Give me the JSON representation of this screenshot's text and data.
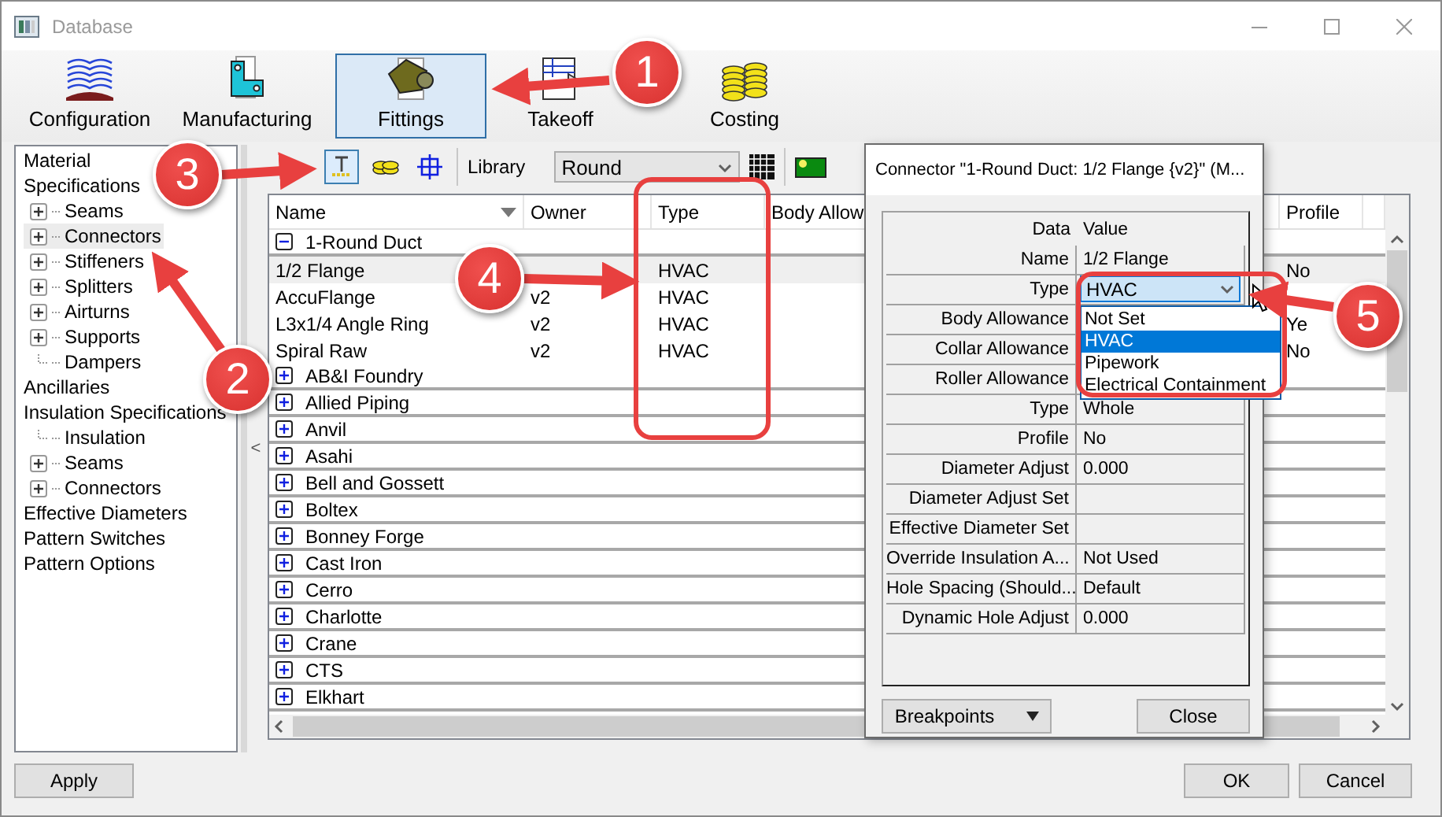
{
  "window": {
    "title": "Database"
  },
  "ribbon": [
    {
      "label": "Configuration",
      "selected": false
    },
    {
      "label": "Manufacturing",
      "selected": false
    },
    {
      "label": "Fittings",
      "selected": true
    },
    {
      "label": "Takeoff",
      "selected": false
    },
    {
      "label": "Costing",
      "selected": false
    }
  ],
  "sidebar": {
    "collapse_button": "<",
    "items": [
      {
        "label": "Material",
        "selected": false
      },
      {
        "label": "Specifications",
        "selected": false,
        "children": [
          {
            "label": "Seams",
            "expandable": true,
            "selected": false
          },
          {
            "label": "Connectors",
            "expandable": true,
            "selected": true
          },
          {
            "label": "Stiffeners",
            "expandable": true,
            "selected": false
          },
          {
            "label": "Splitters",
            "expandable": true,
            "selected": false
          },
          {
            "label": "Airturns",
            "expandable": true,
            "selected": false
          },
          {
            "label": "Supports",
            "expandable": true,
            "selected": false
          },
          {
            "label": "Dampers",
            "expandable": false,
            "selected": false
          }
        ]
      },
      {
        "label": "Ancillaries",
        "selected": false
      },
      {
        "label": "Insulation Specifications",
        "selected": false,
        "children": [
          {
            "label": "Insulation",
            "expandable": false,
            "selected": false
          },
          {
            "label": "Seams",
            "expandable": true,
            "selected": false
          },
          {
            "label": "Connectors",
            "expandable": true,
            "selected": false
          }
        ]
      },
      {
        "label": "Effective Diameters",
        "selected": false
      },
      {
        "label": "Pattern Switches",
        "selected": false
      },
      {
        "label": "Pattern Options",
        "selected": false
      }
    ]
  },
  "toolbar": {
    "tools": [
      {
        "selected": true
      },
      {
        "selected": false
      },
      {
        "selected": false
      }
    ],
    "library_label": "Library",
    "library_value": "Round"
  },
  "table": {
    "columns": [
      {
        "label": "Name",
        "sorted": true
      },
      {
        "label": "Owner",
        "sorted": false
      },
      {
        "label": "Type",
        "sorted": false
      },
      {
        "label": "Body Allow",
        "sorted": false
      },
      {
        "label": "Profile",
        "sorted": false
      }
    ],
    "groups": [
      {
        "name": "1-Round Duct",
        "expanded": true,
        "children": [
          {
            "name": "1/2 Flange",
            "type": "HVAC",
            "profile": "No",
            "selected": true
          },
          {
            "name": "AccuFlange",
            "owner": "v2",
            "type": "HVAC",
            "selected": false
          },
          {
            "name": "L3x1/4 Angle Ring",
            "owner": "v2",
            "type": "HVAC",
            "profile": "Ye",
            "selected": false
          },
          {
            "name": "Spiral Raw",
            "owner": "v2",
            "type": "HVAC",
            "profile": "No",
            "selected": false
          }
        ]
      },
      {
        "name": "AB&I Foundry",
        "expanded": false
      },
      {
        "name": "Allied Piping",
        "expanded": false
      },
      {
        "name": "Anvil",
        "expanded": false
      },
      {
        "name": "Asahi",
        "expanded": false
      },
      {
        "name": "Bell and Gossett",
        "expanded": false
      },
      {
        "name": "Boltex",
        "expanded": false
      },
      {
        "name": "Bonney Forge",
        "expanded": false
      },
      {
        "name": "Cast Iron",
        "expanded": false
      },
      {
        "name": "Cerro",
        "expanded": false
      },
      {
        "name": "Charlotte",
        "expanded": false
      },
      {
        "name": "Crane",
        "expanded": false
      },
      {
        "name": "CTS",
        "expanded": false
      },
      {
        "name": "Elkhart",
        "expanded": false
      }
    ]
  },
  "dialog": {
    "title": "Connector \"1-Round Duct: 1/2 Flange {v2}\" (M...",
    "header": {
      "label": "Data",
      "value": "Value"
    },
    "properties": [
      {
        "label": "Name",
        "value": "1/2 Flange",
        "kind": "text"
      },
      {
        "label": "Type",
        "value": "HVAC",
        "kind": "dropdown"
      },
      {
        "label": "Body Allowance",
        "kind": "text"
      },
      {
        "label": "Collar Allowance",
        "kind": "text"
      },
      {
        "label": "Roller Allowance",
        "kind": "text"
      },
      {
        "label": "Type",
        "value": "Whole",
        "kind": "text"
      },
      {
        "label": "Profile",
        "value": "No",
        "kind": "text"
      },
      {
        "label": "Diameter Adjust",
        "value": "0.000",
        "kind": "text"
      },
      {
        "label": "Diameter Adjust Set",
        "kind": "text"
      },
      {
        "label": "Effective Diameter Set",
        "kind": "text"
      },
      {
        "label": "Override Insulation A...",
        "value": "Not Used",
        "kind": "text"
      },
      {
        "label": "Hole Spacing (Should...",
        "value": "Default",
        "kind": "text"
      },
      {
        "label": "Dynamic Hole Adjust",
        "value": "0.000",
        "kind": "text"
      }
    ],
    "dropdown_options": [
      {
        "label": "Not Set",
        "selected": false
      },
      {
        "label": "HVAC",
        "selected": true
      },
      {
        "label": "Pipework",
        "selected": false
      },
      {
        "label": "Electrical Containment",
        "selected": false
      }
    ],
    "buttons": [
      {
        "label": "Breakpoints",
        "kind": "menu"
      },
      {
        "label": "Close",
        "kind": "plain"
      }
    ]
  },
  "footer": {
    "apply": "Apply",
    "ok": "OK",
    "cancel": "Cancel"
  },
  "callouts": [
    "1",
    "2",
    "3",
    "4",
    "5"
  ]
}
